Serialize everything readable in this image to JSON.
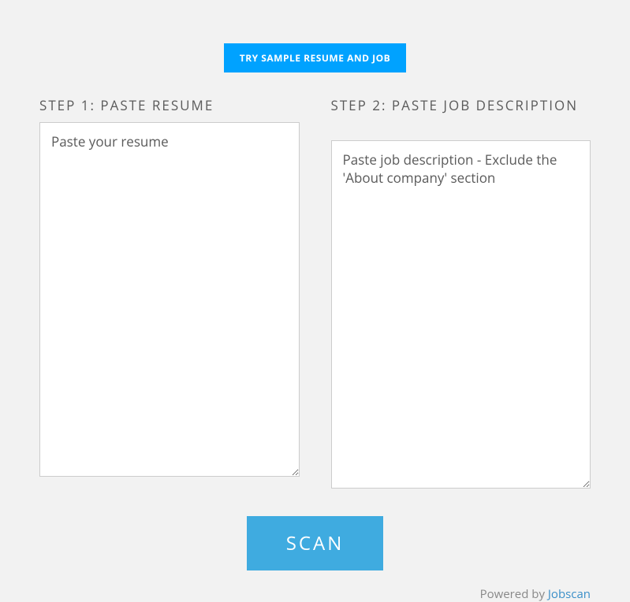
{
  "top_button": {
    "label": "TRY SAMPLE RESUME AND JOB"
  },
  "step1": {
    "label": "STEP 1: PASTE RESUME",
    "placeholder": "Paste your resume",
    "value": ""
  },
  "step2": {
    "label": "STEP 2: PASTE JOB DESCRIPTION",
    "placeholder": "Paste job description - Exclude the 'About company' section",
    "value": ""
  },
  "scan_button": {
    "label": "SCAN"
  },
  "footer": {
    "prefix": "Powered by ",
    "link_text": "Jobscan"
  }
}
